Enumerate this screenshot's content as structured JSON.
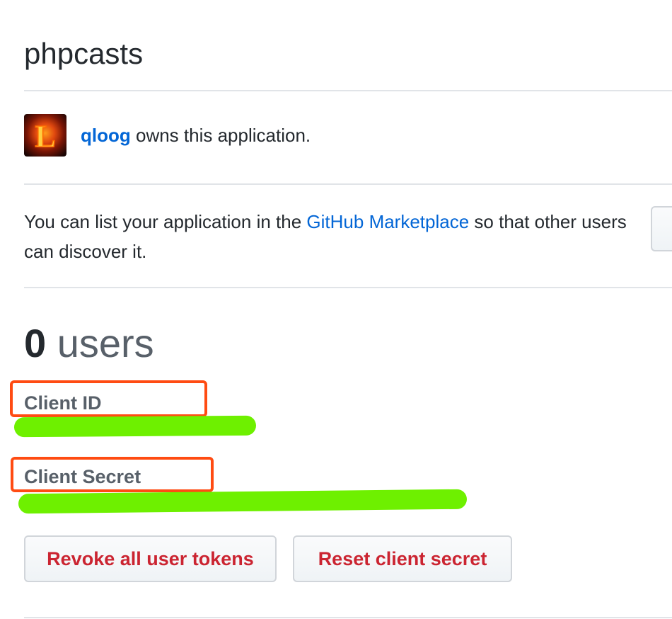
{
  "app": {
    "title": "phpcasts"
  },
  "owner": {
    "avatar_letter": "L",
    "username": "qloog",
    "suffix_text": " owns this application."
  },
  "marketplace": {
    "prefix": "You can list your application in the ",
    "link_text": "GitHub Marketplace",
    "suffix": " so that other users can discover it."
  },
  "stats": {
    "count": "0",
    "unit": " users"
  },
  "credentials": {
    "client_id_label": "Client ID",
    "client_secret_label": "Client Secret"
  },
  "actions": {
    "revoke_label": "Revoke all user tokens",
    "reset_label": "Reset client secret"
  },
  "colors": {
    "link": "#0366d6",
    "danger": "#cb2431",
    "annotation_box": "#ff4b12",
    "redaction": "#6ef000"
  }
}
